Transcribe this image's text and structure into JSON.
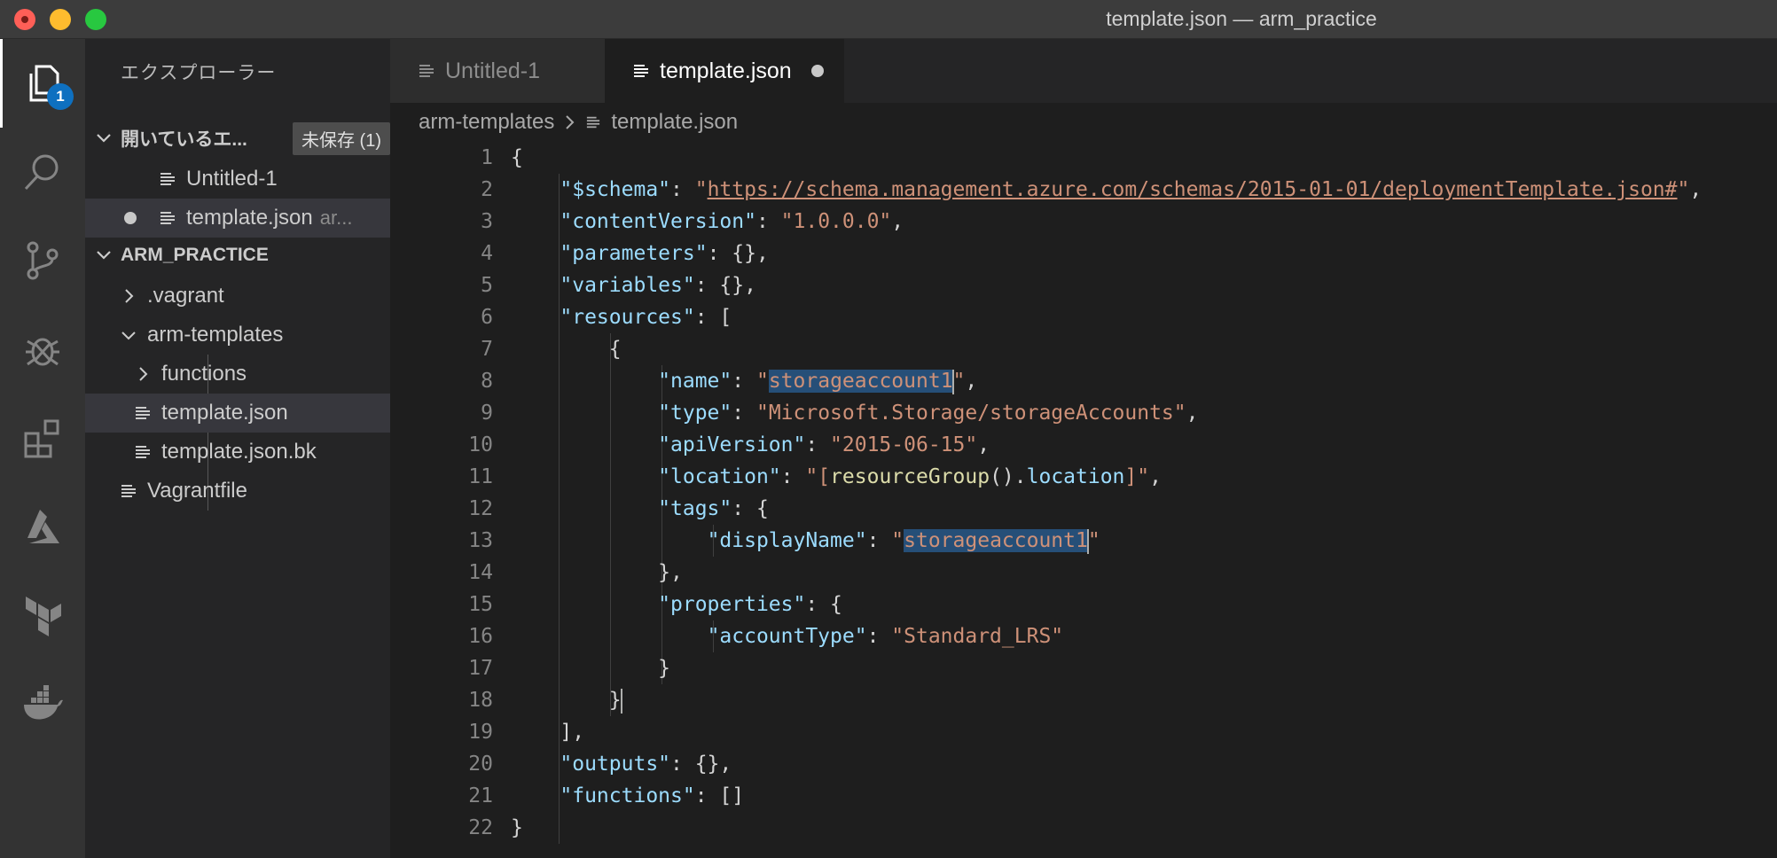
{
  "window": {
    "title": "template.json — arm_practice"
  },
  "activity_bar": {
    "explorer_badge": "1"
  },
  "sidebar": {
    "title": "エクスプローラー",
    "open_editors": {
      "header": "開いているエ...",
      "dirty_label": "未保存 (1)",
      "items": [
        {
          "label": "Untitled-1",
          "desc": ""
        },
        {
          "label": "template.json",
          "desc": "ar..."
        }
      ]
    },
    "workspace": {
      "header": "ARM_PRACTICE",
      "items": [
        {
          "label": ".vagrant"
        },
        {
          "label": "arm-templates"
        },
        {
          "label": "functions"
        },
        {
          "label": "template.json"
        },
        {
          "label": "template.json.bk"
        },
        {
          "label": "Vagrantfile"
        }
      ]
    }
  },
  "tabs": [
    {
      "label": "Untitled-1"
    },
    {
      "label": "template.json"
    }
  ],
  "breadcrumb": {
    "folder": "arm-templates",
    "file": "template.json"
  },
  "editor": {
    "lines": [
      {
        "num": "1",
        "tokens": [
          {
            "t": "{",
            "c": "p"
          }
        ]
      },
      {
        "num": "2",
        "tokens": [
          {
            "t": "    ",
            "c": "p"
          },
          {
            "t": "\"$schema\"",
            "c": "k"
          },
          {
            "t": ": ",
            "c": "p"
          },
          {
            "t": "\"",
            "c": "s"
          },
          {
            "t": "https://schema.management.azure.com/schemas/2015-01-01/deploymentTemplate.json#",
            "c": "su"
          },
          {
            "t": "\"",
            "c": "s"
          },
          {
            "t": ",",
            "c": "p"
          }
        ]
      },
      {
        "num": "3",
        "tokens": [
          {
            "t": "    ",
            "c": "p"
          },
          {
            "t": "\"contentVersion\"",
            "c": "k"
          },
          {
            "t": ": ",
            "c": "p"
          },
          {
            "t": "\"1.0.0.0\"",
            "c": "s"
          },
          {
            "t": ",",
            "c": "p"
          }
        ]
      },
      {
        "num": "4",
        "tokens": [
          {
            "t": "    ",
            "c": "p"
          },
          {
            "t": "\"parameters\"",
            "c": "k"
          },
          {
            "t": ": {},",
            "c": "p"
          }
        ]
      },
      {
        "num": "5",
        "tokens": [
          {
            "t": "    ",
            "c": "p"
          },
          {
            "t": "\"variables\"",
            "c": "k"
          },
          {
            "t": ": {},",
            "c": "p"
          }
        ]
      },
      {
        "num": "6",
        "tokens": [
          {
            "t": "    ",
            "c": "p"
          },
          {
            "t": "\"resources\"",
            "c": "k"
          },
          {
            "t": ": [",
            "c": "p"
          }
        ]
      },
      {
        "num": "7",
        "tokens": [
          {
            "t": "        {",
            "c": "p"
          }
        ]
      },
      {
        "num": "8",
        "tokens": [
          {
            "t": "            ",
            "c": "p"
          },
          {
            "t": "\"name\"",
            "c": "k"
          },
          {
            "t": ": ",
            "c": "p"
          },
          {
            "t": "\"",
            "c": "s"
          },
          {
            "t": "storageaccount1",
            "c": "sh"
          },
          {
            "t": "",
            "c": "cur"
          },
          {
            "t": "\"",
            "c": "s"
          },
          {
            "t": ",",
            "c": "p"
          }
        ]
      },
      {
        "num": "9",
        "tokens": [
          {
            "t": "            ",
            "c": "p"
          },
          {
            "t": "\"type\"",
            "c": "k"
          },
          {
            "t": ": ",
            "c": "p"
          },
          {
            "t": "\"Microsoft.Storage/storageAccounts\"",
            "c": "s"
          },
          {
            "t": ",",
            "c": "p"
          }
        ]
      },
      {
        "num": "10",
        "tokens": [
          {
            "t": "            ",
            "c": "p"
          },
          {
            "t": "\"apiVersion\"",
            "c": "k"
          },
          {
            "t": ": ",
            "c": "p"
          },
          {
            "t": "\"2015-06-15\"",
            "c": "s"
          },
          {
            "t": ",",
            "c": "p"
          }
        ]
      },
      {
        "num": "11",
        "tokens": [
          {
            "t": "            ",
            "c": "p"
          },
          {
            "t": "\"location\"",
            "c": "k"
          },
          {
            "t": ": ",
            "c": "p"
          },
          {
            "t": "\"[",
            "c": "s"
          },
          {
            "t": "resourceGroup",
            "c": "f"
          },
          {
            "t": "().",
            "c": "p"
          },
          {
            "t": "location",
            "c": "k"
          },
          {
            "t": "]\"",
            "c": "s"
          },
          {
            "t": ",",
            "c": "p"
          }
        ]
      },
      {
        "num": "12",
        "tokens": [
          {
            "t": "            ",
            "c": "p"
          },
          {
            "t": "\"tags\"",
            "c": "k"
          },
          {
            "t": ": {",
            "c": "p"
          }
        ]
      },
      {
        "num": "13",
        "tokens": [
          {
            "t": "                ",
            "c": "p"
          },
          {
            "t": "\"displayName\"",
            "c": "k"
          },
          {
            "t": ": ",
            "c": "p"
          },
          {
            "t": "\"",
            "c": "s"
          },
          {
            "t": "storageaccount1",
            "c": "sh"
          },
          {
            "t": "",
            "c": "cur"
          },
          {
            "t": "\"",
            "c": "s"
          }
        ]
      },
      {
        "num": "14",
        "tokens": [
          {
            "t": "            },",
            "c": "p"
          }
        ]
      },
      {
        "num": "15",
        "tokens": [
          {
            "t": "            ",
            "c": "p"
          },
          {
            "t": "\"properties\"",
            "c": "k"
          },
          {
            "t": ": {",
            "c": "p"
          }
        ]
      },
      {
        "num": "16",
        "tokens": [
          {
            "t": "                ",
            "c": "p"
          },
          {
            "t": "\"accountType\"",
            "c": "k"
          },
          {
            "t": ": ",
            "c": "p"
          },
          {
            "t": "\"Standard_LRS\"",
            "c": "s"
          }
        ]
      },
      {
        "num": "17",
        "tokens": [
          {
            "t": "            }",
            "c": "p"
          }
        ]
      },
      {
        "num": "18",
        "tokens": [
          {
            "t": "        }",
            "c": "p"
          },
          {
            "t": "",
            "c": "cur"
          }
        ]
      },
      {
        "num": "19",
        "tokens": [
          {
            "t": "    ],",
            "c": "p"
          }
        ]
      },
      {
        "num": "20",
        "tokens": [
          {
            "t": "    ",
            "c": "p"
          },
          {
            "t": "\"outputs\"",
            "c": "k"
          },
          {
            "t": ": {},",
            "c": "p"
          }
        ]
      },
      {
        "num": "21",
        "tokens": [
          {
            "t": "    ",
            "c": "p"
          },
          {
            "t": "\"functions\"",
            "c": "k"
          },
          {
            "t": ": []",
            "c": "p"
          }
        ]
      },
      {
        "num": "22",
        "tokens": [
          {
            "t": "}",
            "c": "p"
          }
        ]
      }
    ]
  },
  "colors": {
    "activity_bg": "#333333",
    "sidebar_bg": "#252526",
    "editor_bg": "#1e1e1e",
    "badge": "#0e70c0",
    "string": "#ce9178",
    "key": "#9cdcfe",
    "function": "#dcdcaa",
    "selection": "#264f78"
  },
  "icons": [
    "files-icon",
    "search-icon",
    "source-control-icon",
    "debug-icon",
    "extensions-icon",
    "azure-icon",
    "terraform-icon",
    "docker-icon",
    "file-lines-icon",
    "chevron-right-icon",
    "chevron-down-icon"
  ]
}
